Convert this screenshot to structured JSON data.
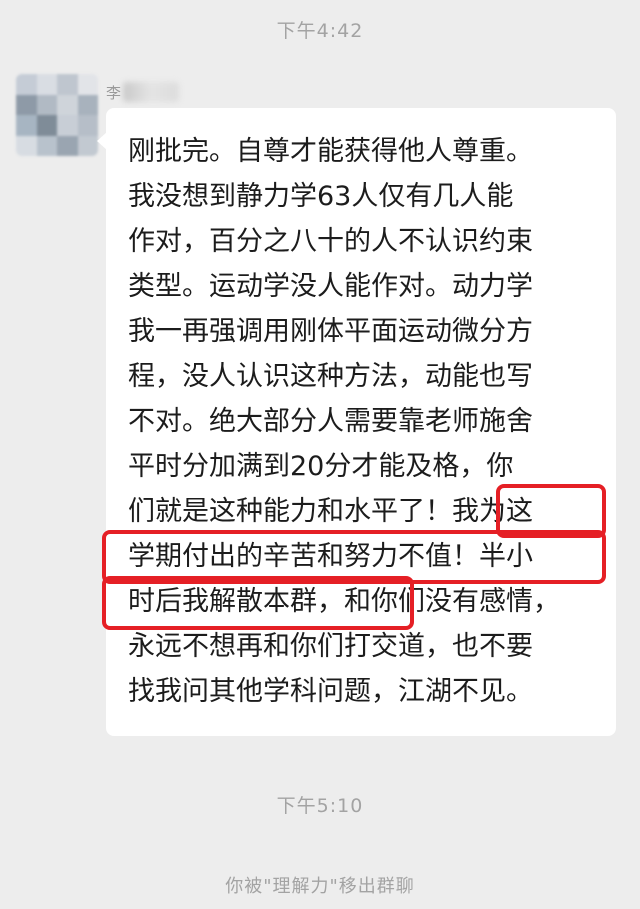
{
  "chat": {
    "time_first": "下午4:42",
    "time_second": "下午5:10",
    "sender_name": "李",
    "message_lines": [
      "刚批完。自尊才能获得他人尊重。",
      "我没想到静力学63人仅有几人能",
      "作对，百分之八十的人不认识约束",
      "类型。运动学没人能作对。动力学",
      "我一再强调用刚体平面运动微分方",
      "程，没人认识这种方法，动能也写",
      "不对。绝大部分人需要靠老师施舍",
      "平时分加满到20分才能及格，你",
      "们就是这种能力和水平了！我为这",
      "学期付出的辛苦和努力不值！半小",
      "时后我解散本群，和你们没有感情，",
      "永远不想再和你们打交道，也不要",
      "找我问其他学科问题，江湖不见。"
    ],
    "system_notice": "你被\"理解力\"移出群聊"
  },
  "colors": {
    "background": "#ededed",
    "bubble": "#ffffff",
    "highlight_box": "#e51f25",
    "meta_text": "#a3a3a3",
    "message_text": "#1c1c1c"
  }
}
